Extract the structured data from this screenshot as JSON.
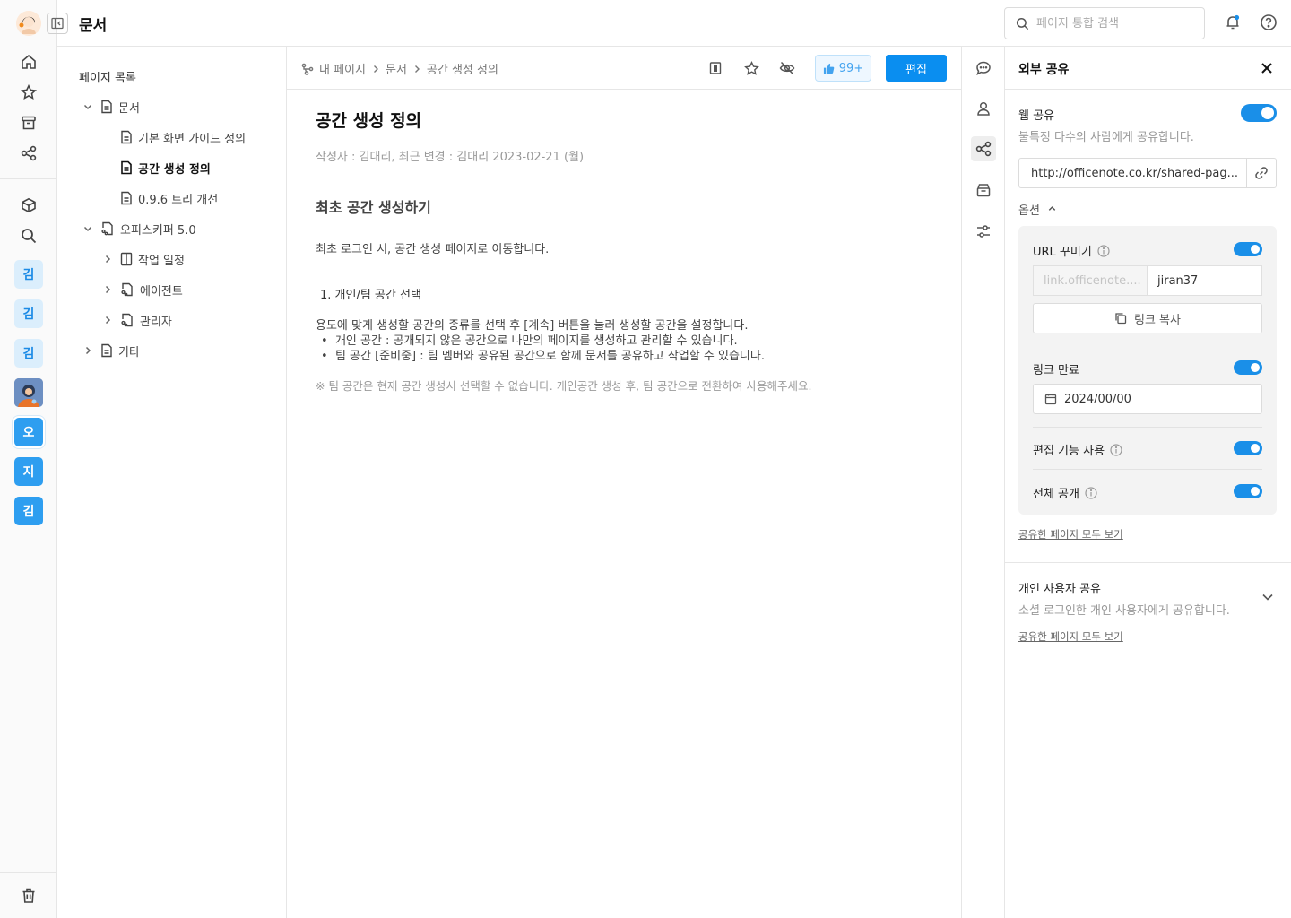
{
  "app": {
    "title": "문서",
    "search_placeholder": "페이지 통합 검색"
  },
  "rail": {
    "workspaces": [
      {
        "label": "김",
        "style": "light"
      },
      {
        "label": "김",
        "style": "light"
      },
      {
        "label": "김",
        "style": "light"
      },
      {
        "label": "",
        "style": "photo"
      },
      {
        "label": "오",
        "style": "solid-selected"
      },
      {
        "label": "지",
        "style": "solid"
      },
      {
        "label": "김",
        "style": "solid"
      }
    ]
  },
  "tree": {
    "title": "페이지 목록",
    "items": [
      {
        "label": "문서",
        "depth": 0,
        "expanded": true,
        "icon": "document-icon"
      },
      {
        "label": "기본 화면 가이드 정의",
        "depth": 1,
        "icon": "document-icon"
      },
      {
        "label": "공간 생성 정의",
        "depth": 1,
        "icon": "document-icon",
        "active": true
      },
      {
        "label": "0.9.6 트리 개선",
        "depth": 1,
        "icon": "document-icon"
      },
      {
        "label": "오피스키퍼 5.0",
        "depth": 0,
        "expanded": true,
        "icon": "shared-document-icon"
      },
      {
        "label": "작업 일정",
        "depth": 1,
        "expanded": false,
        "icon": "board-icon"
      },
      {
        "label": "에이전트",
        "depth": 1,
        "expanded": false,
        "icon": "shared-document-icon"
      },
      {
        "label": "관리자",
        "depth": 1,
        "expanded": false,
        "icon": "shared-document-icon"
      },
      {
        "label": "기타",
        "depth": 0,
        "expanded": false,
        "icon": "document-icon"
      }
    ]
  },
  "breadcrumb": [
    "내 페이지",
    "문서",
    "공간 생성 정의"
  ],
  "toolbar": {
    "like_count": "99+",
    "edit_label": "편집"
  },
  "document": {
    "title": "공간 생성 정의",
    "meta": "작성자 : 김대리,  최근 변경 : 김대리  2023-02-21 (월)",
    "heading": "최초 공간 생성하기",
    "intro": "최초 로그인 시, 공간 생성 페이지로 이동합니다.",
    "list_item": "1. 개인/팀 공간 선택",
    "paragraph": "용도에 맞게 생성할 공간의 종류를 선택 후 [계속] 버튼을 눌러 생성할 공간을 설정합니다.",
    "bullets": [
      "개인 공간 : 공개되지 않은 공간으로 나만의 페이지를 생성하고 관리할 수 있습니다.",
      "팀 공간 [준비중] : 팀 멤버와 공유된 공간으로 함께 문서를 공유하고 작업할 수 있습니다."
    ],
    "note": "※ 팀 공간은 현재 공간 생성시 선택할 수 없습니다. 개인공간 생성 후, 팀 공간으로 전환하여 사용해주세요."
  },
  "share": {
    "title": "외부 공유",
    "web_share_label": "웹 공유",
    "web_share_desc": "불특정 다수의 사람에게 공유합니다.",
    "web_share_on": true,
    "url": "http://officenote.co.kr/shared-pag...",
    "options_label": "옵션",
    "url_custom_label": "URL 꾸미기",
    "url_custom_on": true,
    "slug_prefix": "link.officenote....",
    "slug_value": "jiran37",
    "copy_link_label": "링크 복사",
    "link_expire_label": "링크 만료",
    "link_expire_on": true,
    "expire_date": "2024/00/00",
    "edit_feature_label": "편집 기능 사용",
    "edit_feature_on": true,
    "public_label": "전체 공개",
    "public_on": true,
    "view_all_shared": "공유한 페이지 모두 보기",
    "personal_share_label": "개인 사용자 공유",
    "personal_share_desc": "소셜 로그인한 개인 사용자에게 공유합니다.",
    "view_all_shared_2": "공유한 페이지 모두 보기"
  },
  "colors": {
    "accent": "#0A8EF0",
    "toggle_on": "#1A8FE8"
  }
}
